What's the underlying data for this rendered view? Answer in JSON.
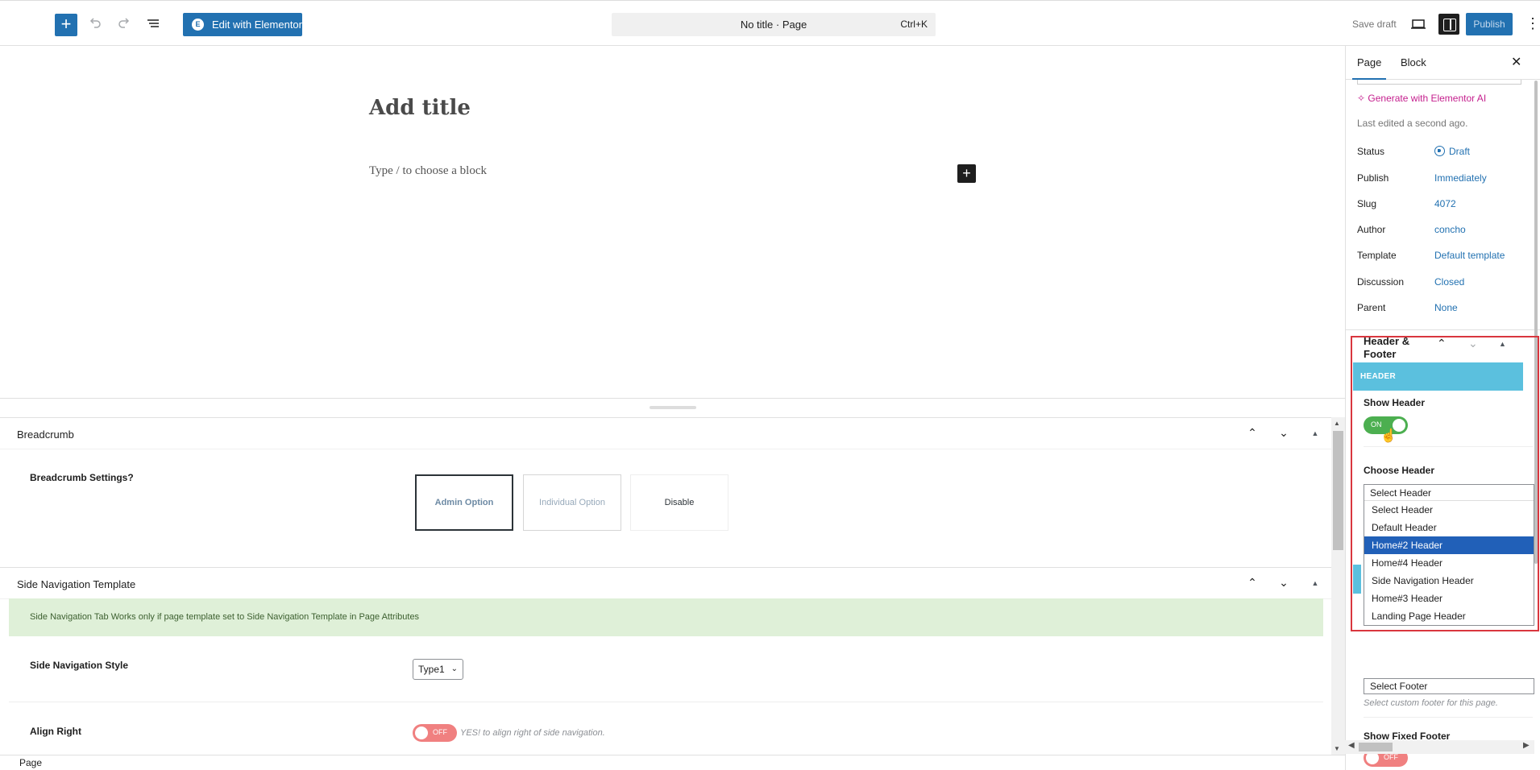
{
  "toolbar": {
    "inserter_icon": "plus-icon",
    "undo_icon": "undo-icon",
    "redo_icon": "redo-icon",
    "outline_icon": "list-view-icon",
    "elementor_label": "Edit with Elementor",
    "elementor_logo": "E",
    "doc_title": "No title · Page",
    "shortcut": "Ctrl+K",
    "save_draft": "Save draft",
    "publish": "Publish",
    "more_icon": "⋮"
  },
  "editor": {
    "title_placeholder": "Add title",
    "block_placeholder": "Type / to choose a block",
    "add_block": "+"
  },
  "metaboxes": {
    "breadcrumb": {
      "title": "Breadcrumb",
      "settings_label": "Breadcrumb Settings?",
      "options": [
        "Admin Option",
        "Individual Option",
        "Disable"
      ],
      "selected": "Admin Option"
    },
    "side_nav": {
      "title": "Side Navigation Template",
      "notice": "Side Navigation Tab Works only if page template set to Side Navigation Template in Page Attributes",
      "style_label": "Side Navigation Style",
      "style_value": "Type1",
      "align_label": "Align Right",
      "align_toggle": "OFF",
      "align_hint": "YES! to align right of side navigation."
    }
  },
  "footer_bar": {
    "breadcrumb": "Page"
  },
  "sidebar": {
    "tabs": [
      "Page",
      "Block"
    ],
    "active_tab": "Page",
    "ai_link": "Generate with Elementor AI",
    "last_edited": "Last edited a second ago.",
    "rows": [
      {
        "label": "Status",
        "value": "Draft"
      },
      {
        "label": "Publish",
        "value": "Immediately"
      },
      {
        "label": "Slug",
        "value": "4072"
      },
      {
        "label": "Author",
        "value": "concho"
      },
      {
        "label": "Template",
        "value": "Default template"
      },
      {
        "label": "Discussion",
        "value": "Closed"
      },
      {
        "label": "Parent",
        "value": "None"
      }
    ],
    "header_footer": {
      "title": "Header & Footer",
      "header_banner": "HEADER",
      "show_header_label": "Show Header",
      "show_header_toggle": "ON",
      "choose_header_label": "Choose Header",
      "header_current": "Select Header",
      "header_options": [
        "Select Header",
        "Default Header",
        "Home#2 Header",
        "Home#4 Header",
        "Side Navigation Header",
        "Home#3 Header",
        "Landing Page Header"
      ],
      "header_highlighted": "Home#2 Header",
      "footer_select": "Select Footer",
      "footer_hint": "Select custom footer for this page.",
      "show_fixed_footer_label": "Show Fixed Footer",
      "fixed_footer_toggle": "OFF"
    }
  },
  "colors": {
    "accent": "#2271b1",
    "ai": "#c5208e",
    "banner": "#5bc0de",
    "toggle_on": "#4caf50",
    "toggle_off": "#f08080",
    "highlight": "#d9363e",
    "option_selected": "#2160b8"
  }
}
